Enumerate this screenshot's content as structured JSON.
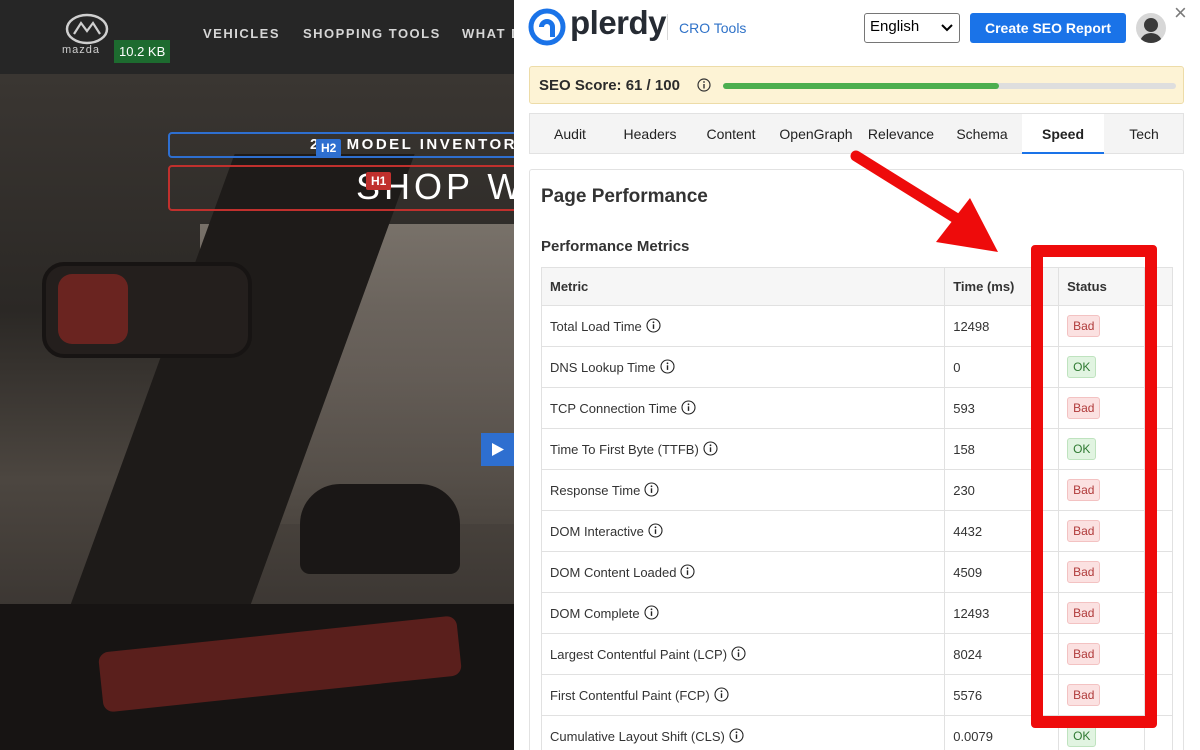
{
  "site": {
    "logo_word": "mazda",
    "page_size": "10.2 KB",
    "nav": [
      "VEHICLES",
      "SHOPPING TOOLS",
      "WHAT D"
    ],
    "h2_heading": "2   S MODEL INVENTOR",
    "h1_heading": "SHOP W",
    "h2_tag": "H2",
    "h1_tag": "H1"
  },
  "panel": {
    "brand": "plerdy",
    "cro_link": "CRO Tools",
    "language": "English",
    "create_button": "Create SEO Report",
    "close_icon": "×",
    "seo_score_label": "SEO Score: 61 / 100",
    "seo_score_value": 61,
    "seo_score_max": 100,
    "tabs": [
      {
        "label": "Audit",
        "active": false
      },
      {
        "label": "Headers",
        "active": false
      },
      {
        "label": "Content",
        "active": false
      },
      {
        "label": "OpenGraph",
        "active": false
      },
      {
        "label": "Relevance",
        "active": false
      },
      {
        "label": "Schema",
        "active": false
      },
      {
        "label": "Speed",
        "active": true
      },
      {
        "label": "Tech",
        "active": false
      }
    ],
    "section_title": "Page Performance",
    "subsection_title": "Performance Metrics",
    "table": {
      "headers": {
        "metric": "Metric",
        "time": "Time (ms)",
        "status": "Status"
      },
      "rows": [
        {
          "metric": "Total Load Time",
          "time": "12498",
          "status": "Bad"
        },
        {
          "metric": "DNS Lookup Time",
          "time": "0",
          "status": "OK"
        },
        {
          "metric": "TCP Connection Time",
          "time": "593",
          "status": "Bad"
        },
        {
          "metric": "Time To First Byte (TTFB)",
          "time": "158",
          "status": "OK"
        },
        {
          "metric": "Response Time",
          "time": "230",
          "status": "Bad"
        },
        {
          "metric": "DOM Interactive",
          "time": "4432",
          "status": "Bad"
        },
        {
          "metric": "DOM Content Loaded",
          "time": "4509",
          "status": "Bad"
        },
        {
          "metric": "DOM Complete",
          "time": "12493",
          "status": "Bad"
        },
        {
          "metric": "Largest Contentful Paint (LCP)",
          "time": "8024",
          "status": "Bad"
        },
        {
          "metric": "First Contentful Paint (FCP)",
          "time": "5576",
          "status": "Bad"
        },
        {
          "metric": "Cumulative Layout Shift (CLS)",
          "time": "0.0079",
          "status": "OK"
        }
      ]
    }
  },
  "colors": {
    "accent": "#1a73e8",
    "annotation_red": "#ee0b0b",
    "score_fill": "#4cae4f",
    "bad": "#b03a3a",
    "ok": "#2f7a32"
  }
}
